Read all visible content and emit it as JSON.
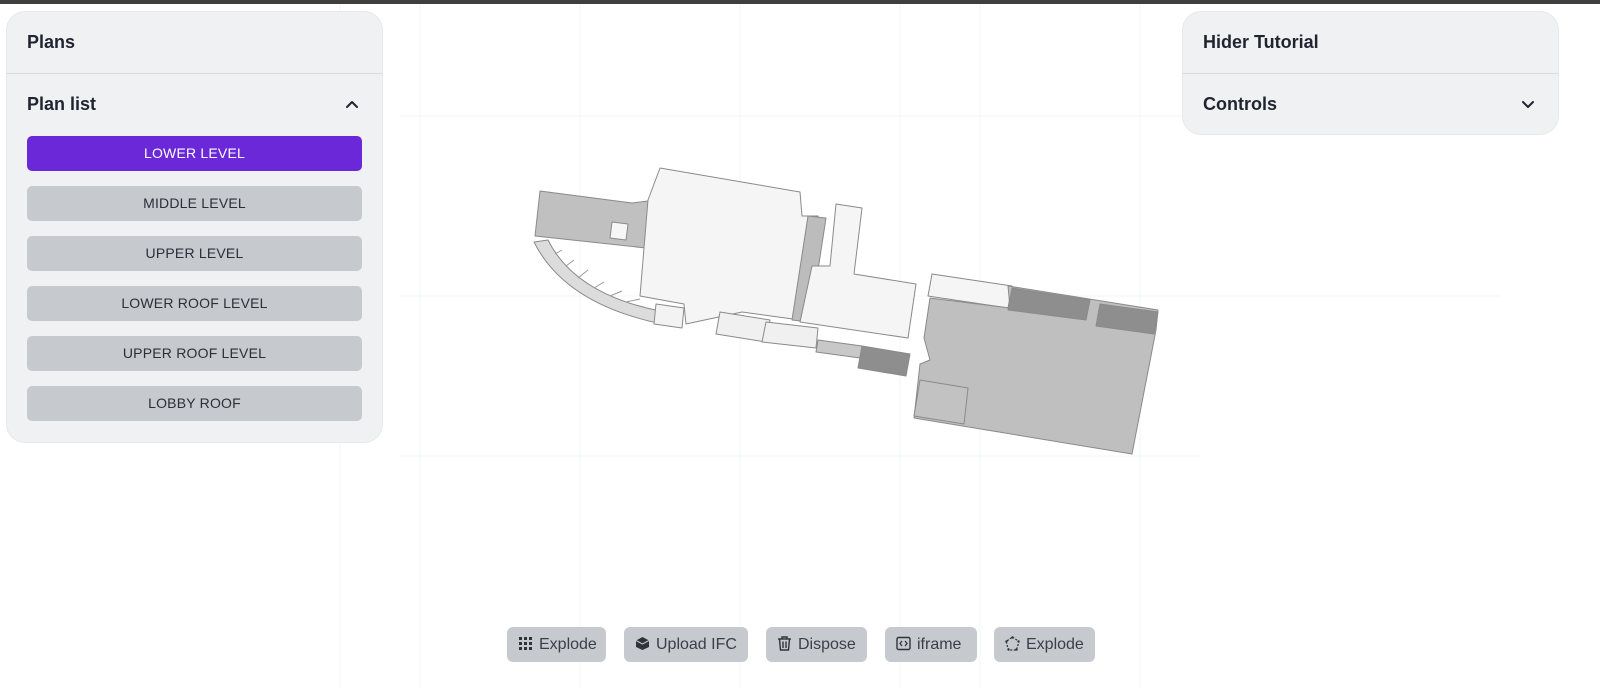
{
  "left_panel": {
    "title": "Plans",
    "section": {
      "title": "Plan list",
      "expanded": true,
      "items": [
        {
          "label": "LOWER LEVEL",
          "active": true
        },
        {
          "label": "MIDDLE LEVEL",
          "active": false
        },
        {
          "label": "UPPER LEVEL",
          "active": false
        },
        {
          "label": "LOWER ROOF LEVEL",
          "active": false
        },
        {
          "label": "UPPER ROOF LEVEL",
          "active": false
        },
        {
          "label": "LOBBY ROOF",
          "active": false
        }
      ]
    }
  },
  "right_panel": {
    "title": "Hider Tutorial",
    "section": {
      "title": "Controls",
      "expanded": false
    }
  },
  "toolbar": {
    "buttons": [
      {
        "label": "Explode",
        "icon": "grid-icon"
      },
      {
        "label": "Upload IFC",
        "icon": "cube-icon"
      },
      {
        "label": "Dispose",
        "icon": "trash-icon"
      },
      {
        "label": "iframe",
        "icon": "code-icon"
      },
      {
        "label": "Explode",
        "icon": "polygon-icon"
      }
    ]
  },
  "colors": {
    "accent": "#6a28d9",
    "button_bg": "#c6cacf",
    "panel_bg": "#f0f1f3"
  }
}
